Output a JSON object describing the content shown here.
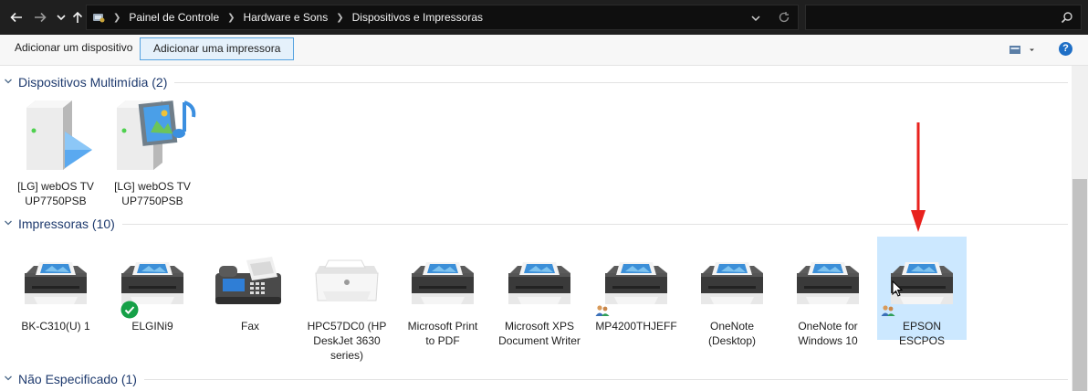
{
  "address": {
    "breadcrumbs": [
      "Painel de Controle",
      "Hardware e Sons",
      "Dispositivos e Impressoras"
    ],
    "search_placeholder": ""
  },
  "icons": {
    "back": "back-arrow-icon",
    "forward": "forward-arrow-icon",
    "recent": "chevron-down-icon",
    "up": "up-arrow-icon",
    "location": "control-panel-icon",
    "dropdown": "chevron-down-icon",
    "refresh": "refresh-icon",
    "search": "search-icon",
    "view": "view-options-icon",
    "help": "help-icon"
  },
  "toolbar": {
    "add_device": "Adicionar um dispositivo",
    "add_printer": "Adicionar uma impressora",
    "help_glyph": "?"
  },
  "sections": {
    "multimedia": {
      "title": "Dispositivos Multimídia (2)",
      "items": [
        {
          "line1": "[LG] webOS TV",
          "line2": "UP7750PSB",
          "icon": "media-device-icon"
        },
        {
          "line1": "[LG] webOS TV",
          "line2": "UP7750PSB",
          "icon": "media-server-icon"
        }
      ]
    },
    "printers": {
      "title": "Impressoras (10)",
      "items": [
        {
          "line1": "BK-C310(U) 1",
          "line2": "",
          "line3": "",
          "icon": "printer-icon"
        },
        {
          "line1": "ELGINi9",
          "line2": "",
          "line3": "",
          "icon": "printer-icon",
          "badge": "default-check-icon"
        },
        {
          "line1": "Fax",
          "line2": "",
          "line3": "",
          "icon": "fax-icon"
        },
        {
          "line1": "HPC57DC0 (HP",
          "line2": "DeskJet 3630",
          "line3": "series)",
          "icon": "hp-printer-icon"
        },
        {
          "line1": "Microsoft Print",
          "line2": "to PDF",
          "line3": "",
          "icon": "printer-icon"
        },
        {
          "line1": "Microsoft XPS",
          "line2": "Document Writer",
          "line3": "",
          "icon": "printer-icon"
        },
        {
          "line1": "MP4200THJEFF",
          "line2": "",
          "line3": "",
          "icon": "printer-icon",
          "badge": "shared-icon"
        },
        {
          "line1": "OneNote",
          "line2": "(Desktop)",
          "line3": "",
          "icon": "printer-icon"
        },
        {
          "line1": "OneNote for",
          "line2": "Windows 10",
          "line3": "",
          "icon": "printer-icon"
        },
        {
          "line1": "EPSON ESCPOS",
          "line2": "",
          "line3": "",
          "icon": "printer-icon",
          "badge": "shared-icon",
          "selected": true
        }
      ]
    },
    "unspecified": {
      "title": "Não Especificado (1)"
    }
  },
  "colors": {
    "accent": "#0078d7",
    "annotation_arrow": "#e8221e",
    "selected_bg": "#cce8ff",
    "section_title": "#1e3a6e"
  }
}
